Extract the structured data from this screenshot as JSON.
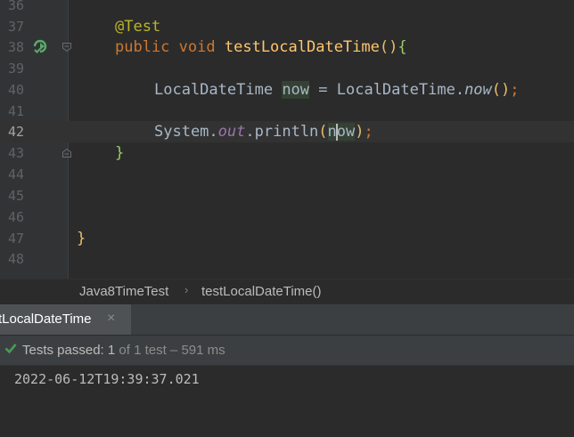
{
  "editor": {
    "lines": [
      {
        "num": "36"
      },
      {
        "num": "37",
        "code_annotation": "@Test"
      },
      {
        "num": "38",
        "kw_public": "public",
        "kw_void": "void",
        "method_name": "testLocalDateTime",
        "parens": "()",
        "brace_open": "{"
      },
      {
        "num": "39"
      },
      {
        "num": "40",
        "type1": "LocalDateTime",
        "var_now": "now",
        "assign": " = ",
        "type2": "LocalDateTime",
        "dot": ".",
        "call_now": "now",
        "parens": "()",
        "semi": ";"
      },
      {
        "num": "41"
      },
      {
        "num": "42",
        "system": "System",
        "dot1": ".",
        "field_out": "out",
        "dot2": ".",
        "println": "println",
        "paren_open": "(",
        "arg_a": "n",
        "arg_b": "ow",
        "paren_close": ")",
        "semi": ";"
      },
      {
        "num": "43",
        "brace_close": "}"
      },
      {
        "num": "44"
      },
      {
        "num": "45"
      },
      {
        "num": "46"
      },
      {
        "num": "47",
        "class_close": "}"
      },
      {
        "num": "48"
      }
    ],
    "colors": {
      "background": "#2b2b2b",
      "keyword": "#cc7832",
      "annotation": "#bbb529",
      "method": "#ffc66d",
      "static_field": "#9876aa",
      "text": "#a9b7c6",
      "run_icon": "#59a869"
    }
  },
  "breadcrumbs": {
    "class_name": "Java8TimeTest",
    "separator": "›",
    "method": "testLocalDateTime()"
  },
  "run_panel": {
    "tab_label": "tLocalDateTime",
    "tab_close": "×",
    "status_prefix": "Tests passed: ",
    "passed_count": "1",
    "status_rest": " of 1 test – 591 ms",
    "status_color": "#499c54",
    "output_line": "2022-06-12T19:39:37.021"
  }
}
